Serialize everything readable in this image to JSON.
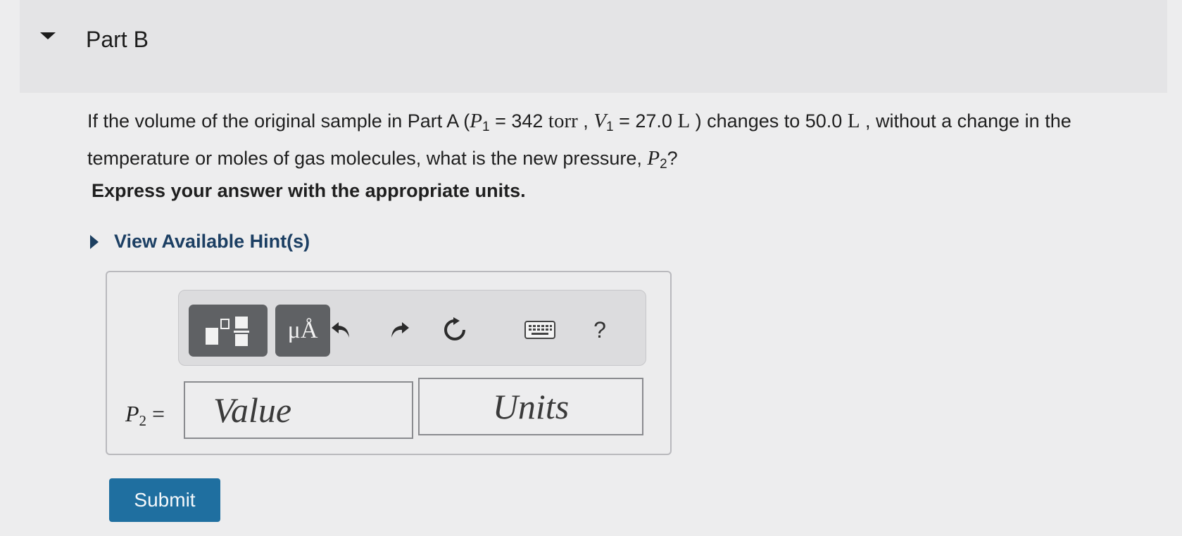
{
  "part": {
    "title": "Part B"
  },
  "question": {
    "intro": "If the volume of the original sample in Part A (",
    "p1_symbol": "P",
    "p1_sub": "1",
    "p1_value": " = 342 ",
    "p1_unit": "torr",
    "sep1": " , ",
    "v1_symbol": "V",
    "v1_sub": "1",
    "v1_value": " = 27.0 ",
    "v1_unit": "L",
    "mid": " ) changes to 50.0 ",
    "v2_unit": "L",
    "tail": " , without a change in the temperature or moles of gas molecules, what is the new pressure, ",
    "p2_symbol": "P",
    "p2_sub": "2",
    "end": "?"
  },
  "instruction": "Express your answer with the appropriate units.",
  "hints": {
    "label": "View Available Hint(s)"
  },
  "toolbar": {
    "units_button_glyph": "μÅ",
    "help_glyph": "?",
    "icons": [
      "templates-icon",
      "units-icon",
      "undo-icon",
      "redo-icon",
      "reset-icon",
      "keyboard-icon",
      "help-icon"
    ]
  },
  "answer": {
    "label_symbol": "P",
    "label_sub": "2",
    "label_eq": " =",
    "value_placeholder": "Value",
    "units_placeholder": "Units"
  },
  "submit": {
    "label": "Submit"
  },
  "colors": {
    "submit_bg": "#1f6fa0",
    "hint_text": "#1c3f63",
    "toolbar_button": "#5f6164"
  }
}
